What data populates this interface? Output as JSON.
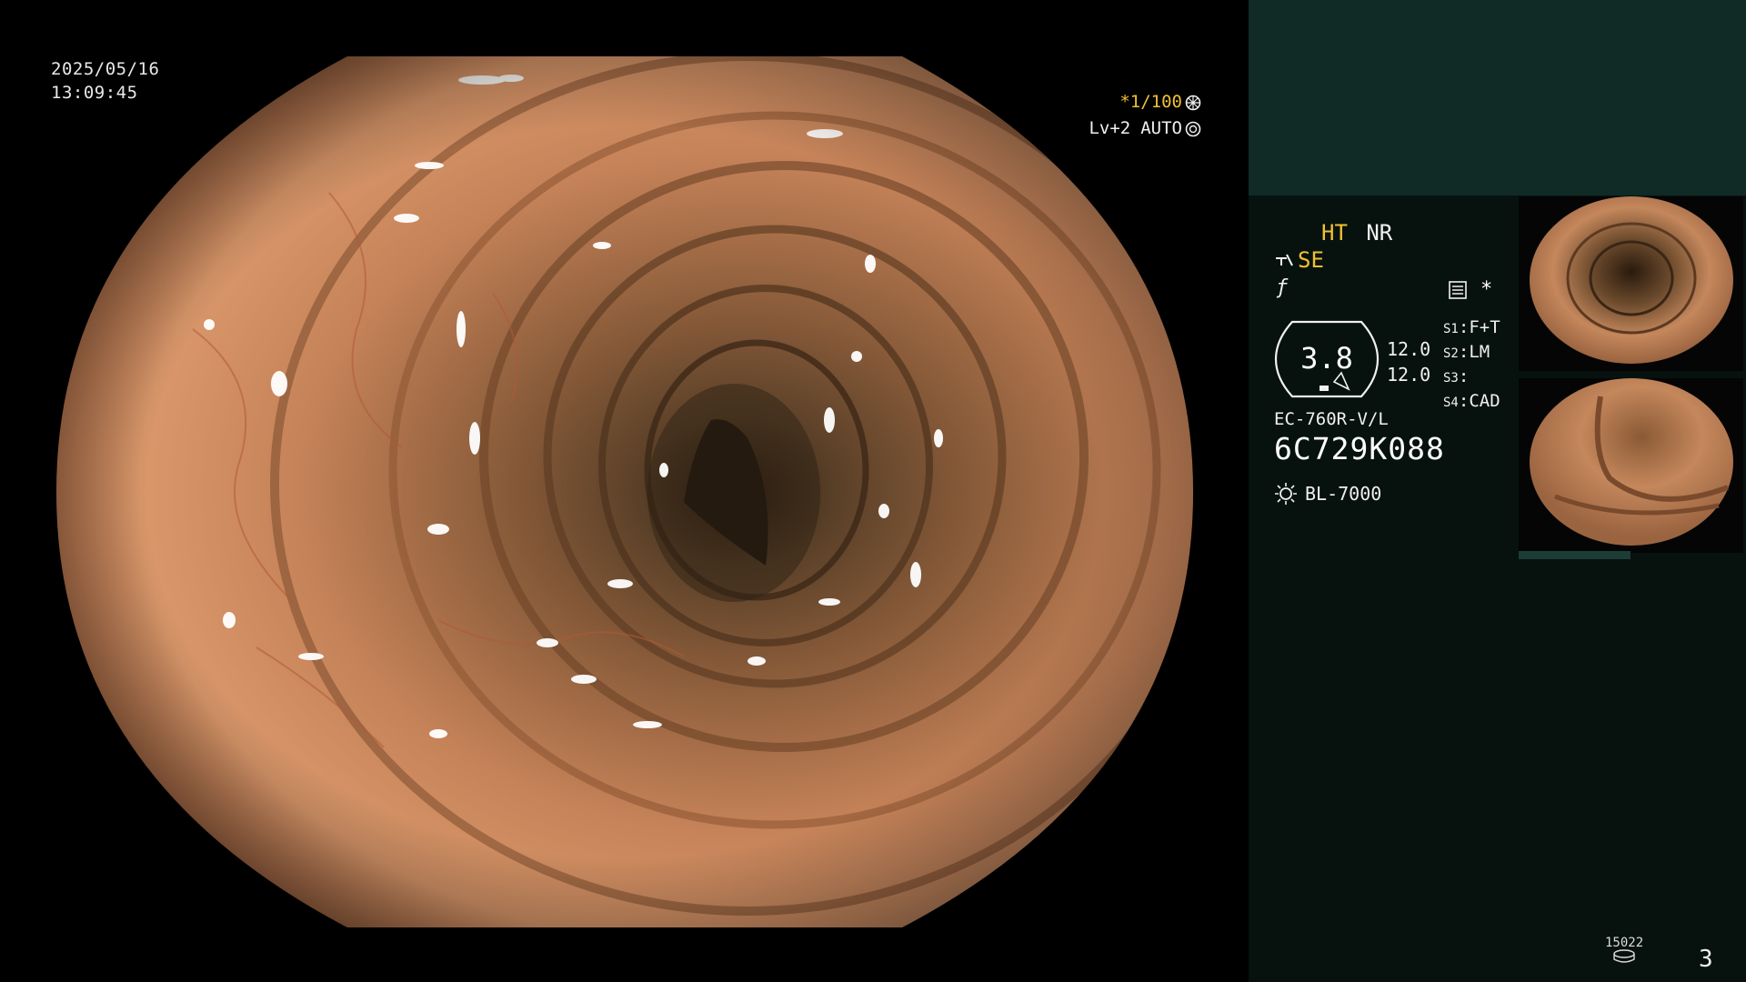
{
  "overlay": {
    "date": "2025/05/16",
    "time": "13:09:45",
    "shutter": "*1/100",
    "level": "Lv+2",
    "iris": "AUTO"
  },
  "panel": {
    "ht": "HT",
    "nr": "NR",
    "se": "SE",
    "gauge_value": "3.8",
    "setting_a": "12.0",
    "setting_b": "12.0",
    "switches": [
      {
        "key": "S1",
        "value": "F+T"
      },
      {
        "key": "S2",
        "value": "LM"
      },
      {
        "key": "S3",
        "value": ""
      },
      {
        "key": "S4",
        "value": "CAD"
      }
    ],
    "scope_model": "EC-760R-V/L",
    "scope_serial": "6C729K088",
    "light_source": "BL-7000",
    "counter": "15022",
    "page": "3"
  },
  "icons": [
    "freeze-icon",
    "auto-iris-icon",
    "structure-enhance-icon",
    "record-icon",
    "light-source-icon",
    "disk-icon"
  ],
  "colors": {
    "accent_yellow": "#f0c030",
    "panel_bg": "#07120f",
    "panel_top": "#102a26",
    "mucosa": "#c9845a"
  }
}
